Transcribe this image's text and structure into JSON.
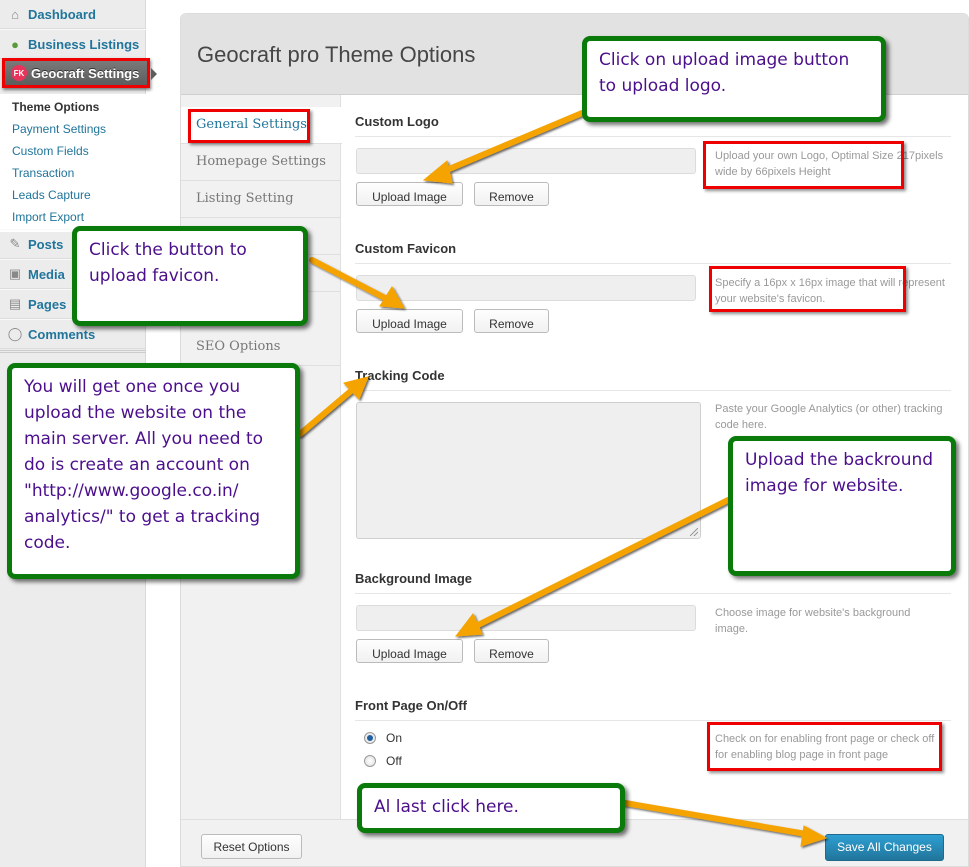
{
  "sidebar": {
    "items": [
      {
        "label": "Dashboard",
        "icon": "home-icon"
      },
      {
        "label": "Business Listings",
        "icon": "map-pin-icon"
      },
      {
        "label": "Geocraft Settings",
        "icon": "geocraft-logo-icon",
        "current": true
      },
      {
        "label": "Posts",
        "icon": "pushpin-icon"
      },
      {
        "label": "Media",
        "icon": "media-icon"
      },
      {
        "label": "Pages",
        "icon": "pages-icon"
      },
      {
        "label": "Comments",
        "icon": "comment-bubble-icon"
      }
    ],
    "submenu": [
      {
        "label": "Theme Options",
        "current": true
      },
      {
        "label": "Payment Settings"
      },
      {
        "label": "Custom Fields"
      },
      {
        "label": "Transaction"
      },
      {
        "label": "Leads Capture"
      },
      {
        "label": "Import Export"
      }
    ],
    "geocraft_icon_text": "FK"
  },
  "panel": {
    "title": "Geocraft pro Theme Options",
    "tabs": [
      {
        "label": "General Settings",
        "active": true
      },
      {
        "label": "Homepage Settings"
      },
      {
        "label": "Listing Setting"
      },
      {
        "label": ""
      },
      {
        "label": ""
      },
      {
        "label": "SEO Options"
      }
    ],
    "sections": {
      "custom_logo": {
        "title": "Custom Logo",
        "value": "",
        "upload_label": "Upload Image",
        "remove_label": "Remove",
        "help": "Upload your own Logo, Optimal Size 217pixels wide by 66pixels Height"
      },
      "custom_favicon": {
        "title": "Custom Favicon",
        "value": "",
        "upload_label": "Upload Image",
        "remove_label": "Remove",
        "help": "Specify a 16px x 16px image that will represent your website's favicon."
      },
      "tracking_code": {
        "title": "Tracking Code",
        "value": "",
        "help": "Paste your Google Analytics (or other) tracking code here."
      },
      "background_image": {
        "title": "Background Image",
        "value": "",
        "upload_label": "Upload Image",
        "remove_label": "Remove",
        "help": "Choose image for website's background image."
      },
      "front_page": {
        "title": "Front Page On/Off",
        "options": [
          "On",
          "Off"
        ],
        "selected": "On",
        "help": "Check on for enabling front page or check off for enabling blog page in front page"
      }
    },
    "footer": {
      "reset_label": "Reset Options",
      "save_label": "Save All Changes"
    }
  },
  "callouts": {
    "logo": "Click on upload image button to upload logo.",
    "favicon": "Click the button to upload favicon.",
    "tracking": "You will get one once you upload the website on the main server. All you need to do is create an account on \"http://www.google.co.in/ analytics/\" to get a tracking code.",
    "background": "Upload the backround image for website.",
    "save": "Al last click here."
  },
  "colors": {
    "callout_border": "#0a7a0a",
    "callout_text": "#4b0f8c",
    "highlight_box": "#ee0000",
    "arrow": "#f5a300",
    "link": "#21759b",
    "primary_button": "#21759b"
  }
}
